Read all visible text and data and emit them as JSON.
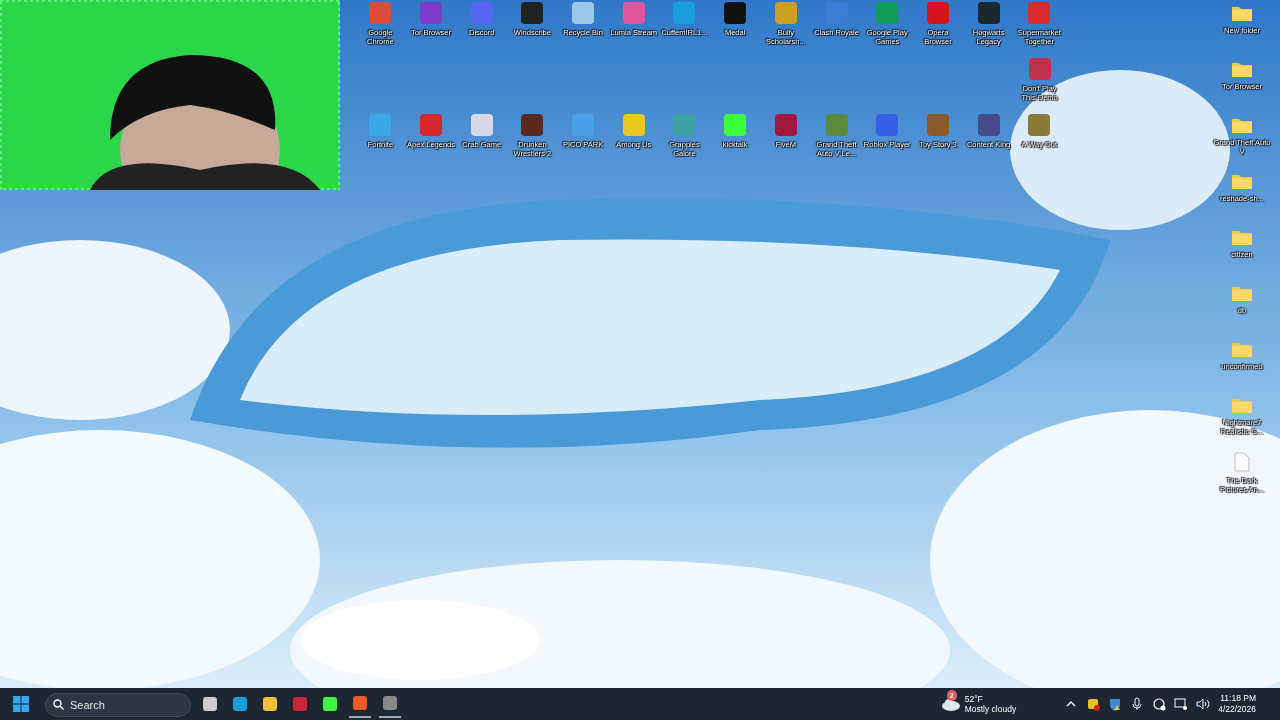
{
  "desktop": {
    "top_row": [
      {
        "label": "Google Chrome",
        "color": "#dd4b39"
      },
      {
        "label": "Tor Browser",
        "color": "#7d3cc8"
      },
      {
        "label": "Discord",
        "color": "#5865f2"
      },
      {
        "label": "Windscribe",
        "color": "#222222"
      },
      {
        "label": "Recycle Bin",
        "color": "#9cc8e8"
      },
      {
        "label": "Lumia Stream",
        "color": "#e0569a"
      },
      {
        "label": "CuffemIRL1...",
        "color": "#1aa0d8"
      },
      {
        "label": "Medal",
        "color": "#111111"
      },
      {
        "label": "Bully Scholarsh...",
        "color": "#c9a020"
      },
      {
        "label": "Clash Royale",
        "color": "#3a7bd5"
      },
      {
        "label": "Google Play Games",
        "color": "#0f9d58"
      },
      {
        "label": "Opera Browser",
        "color": "#d3161e"
      },
      {
        "label": "Hogwarts Legacy",
        "color": "#1a2a2a"
      },
      {
        "label": "Supermarket Together",
        "color": "#d92b2b"
      }
    ],
    "middle_row": [
      {
        "label": "Don't Play This Demo",
        "color": "#c0304a"
      }
    ],
    "bottom_row": [
      {
        "label": "Fortnite",
        "color": "#3aa7e6"
      },
      {
        "label": "Apex Legends",
        "color": "#d8262e"
      },
      {
        "label": "Crab Game",
        "color": "#d8d8e8"
      },
      {
        "label": "Drunken Wrestlers 2",
        "color": "#5a2a20"
      },
      {
        "label": "PICO PARK",
        "color": "#4aa0e8"
      },
      {
        "label": "Among Us",
        "color": "#e8c820"
      },
      {
        "label": "Grapples Galore",
        "color": "#3aa0a0"
      },
      {
        "label": "kicktalk",
        "color": "#3cff3c"
      },
      {
        "label": "FiveM",
        "color": "#a01840"
      },
      {
        "label": "Grand Theft Auto V Le...",
        "color": "#5a8a3a"
      },
      {
        "label": "Roblox Player",
        "color": "#3560e6"
      },
      {
        "label": "Toy Story 3",
        "color": "#8a5a2a"
      },
      {
        "label": "Content King",
        "color": "#4a4a8a"
      },
      {
        "label": "A Way Out",
        "color": "#8a7a3a"
      }
    ],
    "right_column": [
      {
        "label": "New folder",
        "kind": "folder"
      },
      {
        "label": "Tor Browser",
        "kind": "folder"
      },
      {
        "label": "Grand Theft Auto V",
        "kind": "folder"
      },
      {
        "label": "reshade-sh...",
        "kind": "folder"
      },
      {
        "label": "citizen",
        "kind": "folder"
      },
      {
        "label": "db",
        "kind": "folder"
      },
      {
        "label": "unconfirmed",
        "kind": "folder"
      },
      {
        "label": "Nightmare7 Realistic G...",
        "kind": "folder"
      },
      {
        "label": "The Dark Pictures An...",
        "kind": "file"
      }
    ]
  },
  "taskbar": {
    "search": {
      "placeholder": "Search"
    },
    "apps": [
      {
        "color": "#cccccc",
        "running": false
      },
      {
        "color": "#1aa0d8",
        "running": false
      },
      {
        "color": "#f0c040",
        "running": false
      },
      {
        "color": "#c8283c",
        "running": false
      },
      {
        "color": "#3cff3c",
        "running": false
      },
      {
        "color": "#f05a24",
        "running": true
      },
      {
        "color": "#888888",
        "running": true
      }
    ],
    "weather": {
      "badge": "2",
      "temperature": "52°F",
      "condition": "Mostly cloudy"
    },
    "clock": {
      "time": "11:18 PM",
      "date": "4/22/2026"
    }
  }
}
